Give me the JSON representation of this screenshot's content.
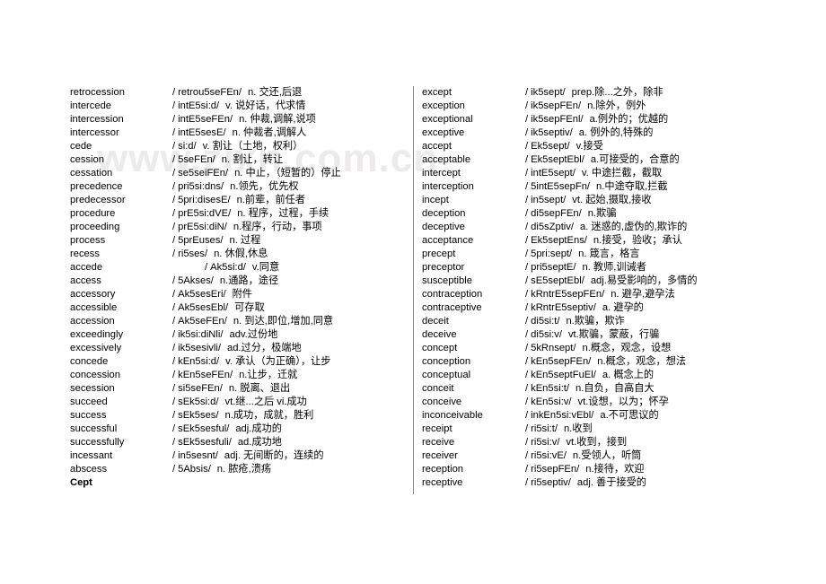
{
  "page": {
    "watermark": "www.zixn.com.cn",
    "background_color": "#ffffff",
    "text_color": "#000000",
    "watermark_color": "#eceaea",
    "divider_color": "#8a8a8a"
  },
  "columns": {
    "left": {
      "entries": [
        {
          "word": "retrocession",
          "slash": "/",
          "phonetic": "retrou5seFEn/",
          "definition": "n. 交还,后退"
        },
        {
          "word": "intercede",
          "slash": "/",
          "phonetic": "intE5si:d/",
          "definition": "v. 说好话，代求情"
        },
        {
          "word": "intercession",
          "slash": "/",
          "phonetic": "intE5seFEn/",
          "definition": "n. 仲裁,调解,说项"
        },
        {
          "word": "intercessor",
          "slash": "/",
          "phonetic": "intE5sesE/",
          "definition": "n. 仲裁者,调解人"
        },
        {
          "word": "cede",
          "slash": "/",
          "phonetic": "si:d/",
          "definition": "v. 割让（土地，权利）"
        },
        {
          "word": "cession",
          "slash": "/",
          "phonetic": "5seFEn/",
          "definition": "n. 割让，转让"
        },
        {
          "word": "cessation",
          "slash": "/",
          "phonetic": "se5seiFEn/",
          "definition": "n. 中止，（短暂的）停止"
        },
        {
          "word": "precedence",
          "slash": "/",
          "phonetic": "pri5si:dns/",
          "definition": "n.领先，优先权"
        },
        {
          "word": "predecessor",
          "slash": "/",
          "phonetic": "5pri:disesE/",
          "definition": "n.前辈，前任者"
        },
        {
          "word": "procedure",
          "slash": "/",
          "phonetic": "prE5si:dVE/",
          "definition": "n. 程序，过程，手续"
        },
        {
          "word": "proceeding",
          "slash": "/",
          "phonetic": "prE5si:diN/",
          "definition": "n.程序，行动，事项"
        },
        {
          "word": "process",
          "slash": "/",
          "phonetic": "5prEuses/",
          "definition": "n. 过程"
        },
        {
          "word": "recess",
          "slash": "/",
          "phonetic": "ri5ses/",
          "definition": "n. 休假,休息"
        },
        {
          "word": "accede",
          "slash": "/",
          "phonetic": "Ak5si:d/",
          "definition": "v.同意",
          "indent": true
        },
        {
          "word": "access",
          "slash": "/",
          "phonetic": "5Akses/",
          "definition": "n.通路，途径"
        },
        {
          "word": "accessory",
          "slash": "/",
          "phonetic": "Ak5sesEri/",
          "definition": "附件"
        },
        {
          "word": "accessible",
          "slash": "/",
          "phonetic": "Ak5sesEbl/",
          "definition": "可存取"
        },
        {
          "word": "accession",
          "slash": "/",
          "phonetic": "Ak5seFEn/",
          "definition": "n. 到达,即位,增加,同意"
        },
        {
          "word": "exceedingly",
          "slash": "/",
          "phonetic": "ik5si:diNli/",
          "definition": "adv.过份地"
        },
        {
          "word": "excessively",
          "slash": "/",
          "phonetic": "ik5sesivli/",
          "definition": "ad.过分，极端地"
        },
        {
          "word": "concede",
          "slash": "/",
          "phonetic": "kEn5si:d/",
          "definition": "v. 承认（为正确），让步"
        },
        {
          "word": "concession",
          "slash": "/",
          "phonetic": "kEn5seFEn/",
          "definition": "n.让步，迁就"
        },
        {
          "word": "secession",
          "slash": "/",
          "phonetic": "si5seFEn/",
          "definition": "n. 脱离、退出"
        },
        {
          "word": "succeed",
          "slash": "/",
          "phonetic": "sEk5si:d/",
          "definition": "vt.继...之后 vi.成功"
        },
        {
          "word": "success",
          "slash": "/",
          "phonetic": "sEk5ses/",
          "definition": "n.成功，成就，胜利"
        },
        {
          "word": "successful",
          "slash": "/",
          "phonetic": "sEk5sesful/",
          "definition": "adj.成功的"
        },
        {
          "word": "successfully",
          "slash": "/",
          "phonetic": "sEk5sesfuli/",
          "definition": "ad.成功地"
        },
        {
          "word": "incessant",
          "slash": "/",
          "phonetic": "in5sesnt/",
          "definition": "adj. 无间断的，连续的"
        },
        {
          "word": "abscess",
          "slash": "/",
          "phonetic": "5Absis/",
          "definition": "n. 脓疮,溃疡"
        }
      ],
      "heading": "Cept"
    },
    "right": {
      "entries": [
        {
          "word": "except",
          "slash": "/",
          "phonetic": "ik5sept/",
          "definition": "prep.除...之外，除非"
        },
        {
          "word": "exception",
          "slash": "/",
          "phonetic": "ik5sepFEn/",
          "definition": "n.除外，例外"
        },
        {
          "word": "exceptional",
          "slash": "/",
          "phonetic": "ik5sepFEnl/",
          "definition": "a.例外的；优越的"
        },
        {
          "word": "exceptive",
          "slash": "/",
          "phonetic": "ik5septiv/",
          "definition": "a. 例外的,特殊的"
        },
        {
          "word": "accept",
          "slash": "/",
          "phonetic": "Ek5sept/",
          "definition": "v.接受"
        },
        {
          "word": "acceptable",
          "slash": "/",
          "phonetic": "Ek5septEbl/",
          "definition": "a.可接受的，合意的"
        },
        {
          "word": "intercept",
          "slash": "/",
          "phonetic": "intE5sept/",
          "definition": "v. 中途拦截，截取"
        },
        {
          "word": "interception",
          "slash": "/",
          "phonetic": "5intE5sepFn/",
          "definition": "n.中途夺取,拦截"
        },
        {
          "word": "incept",
          "slash": "/",
          "phonetic": "in5sept/",
          "definition": "vt. 起始,摄取,接收"
        },
        {
          "word": "deception",
          "slash": "/",
          "phonetic": "di5sepFEn/",
          "definition": "n.欺骗"
        },
        {
          "word": "deceptive",
          "slash": "/",
          "phonetic": "di5sZptiv/",
          "definition": "a. 迷惑的,虚伪的,欺诈的"
        },
        {
          "word": "acceptance",
          "slash": "/",
          "phonetic": "Ek5septEns/",
          "definition": "n.接受，验收；承认"
        },
        {
          "word": "precept",
          "slash": "/",
          "phonetic": "5pri:sept/",
          "definition": "n. 箴言，格言"
        },
        {
          "word": "preceptor",
          "slash": "/",
          "phonetic": "pri5septE/",
          "definition": "n. 教师,训诫者"
        },
        {
          "word": "susceptible",
          "slash": "/",
          "phonetic": "sE5septEbl/",
          "definition": "adj.易受影响的，多情的"
        },
        {
          "word": "contraception",
          "slash": "/",
          "phonetic": "kRntrE5sepFEn/",
          "definition": "n. 避孕,避孕法"
        },
        {
          "word": "contraceptive",
          "slash": "/",
          "phonetic": "kRntrE5septiv/",
          "definition": "a. 避孕的"
        },
        {
          "word": "deceit",
          "slash": "/",
          "phonetic": "di5si:t/",
          "definition": "n.欺骗，欺诈"
        },
        {
          "word": "deceive",
          "slash": "/",
          "phonetic": "di5si:v/",
          "definition": "vt.欺骗，蒙蔽，行骗"
        },
        {
          "word": "concept",
          "slash": "/",
          "phonetic": "5kRnsept/",
          "definition": "n.概念，观念，设想"
        },
        {
          "word": "conception",
          "slash": "/",
          "phonetic": "kEn5sepFEn/",
          "definition": "n.概念，观念，想法"
        },
        {
          "word": "conceptual",
          "slash": "/",
          "phonetic": "kEn5septFuEl/",
          "definition": "a. 概念上的"
        },
        {
          "word": "conceit",
          "slash": "/",
          "phonetic": "kEn5si:t/",
          "definition": "n.自负，自高自大"
        },
        {
          "word": "conceive",
          "slash": "/",
          "phonetic": "kEn5si:v/",
          "definition": "vt.设想，以为；怀孕"
        },
        {
          "word": "inconceivable",
          "slash": "/",
          "phonetic": "inkEn5si:vEbl/",
          "definition": "a.不可思议的"
        },
        {
          "word": "receipt",
          "slash": "/",
          "phonetic": "ri5si:t/",
          "definition": "n.收到"
        },
        {
          "word": "receive",
          "slash": "/",
          "phonetic": "ri5si:v/",
          "definition": "vt.收到，接到"
        },
        {
          "word": "receiver",
          "slash": "/",
          "phonetic": "ri5si:vE/",
          "definition": "n.受领人，听筒"
        },
        {
          "word": "reception",
          "slash": "/",
          "phonetic": "ri5sepFEn/",
          "definition": "n.接待，欢迎"
        },
        {
          "word": "receptive",
          "slash": "/",
          "phonetic": "ri5septiv/",
          "definition": "adj. 善于接受的"
        }
      ]
    }
  }
}
